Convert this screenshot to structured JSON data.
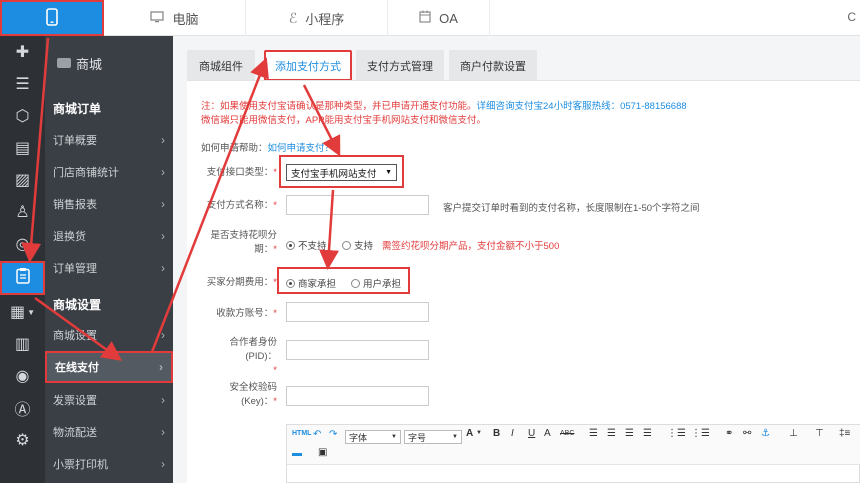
{
  "topbar": {
    "phone_icon": "phone-icon",
    "tabs": [
      {
        "label": "电脑",
        "icon": "monitor-icon"
      },
      {
        "label": "小程序",
        "icon": "miniprogram-icon"
      },
      {
        "label": "OA",
        "icon": "calendar-icon"
      }
    ],
    "right_label": "C"
  },
  "rail": {
    "items": [
      {
        "icon": "puzzle-icon",
        "glyph": "✚"
      },
      {
        "icon": "list-icon",
        "glyph": "☰"
      },
      {
        "icon": "cube-icon",
        "glyph": "⬡"
      },
      {
        "icon": "document-icon",
        "glyph": "▤"
      },
      {
        "icon": "image-icon",
        "glyph": "▨"
      },
      {
        "icon": "user-icon",
        "glyph": "♙"
      },
      {
        "icon": "game-icon",
        "glyph": "◎"
      },
      {
        "icon": "clipboard-icon",
        "glyph": "▣"
      },
      {
        "icon": "grid-icon",
        "glyph": "▦"
      },
      {
        "icon": "order-icon",
        "glyph": "▥"
      },
      {
        "icon": "chat-icon",
        "glyph": "◉"
      },
      {
        "icon": "appstore-icon",
        "glyph": "Ⓐ"
      },
      {
        "icon": "settings-icon",
        "glyph": "⚙"
      }
    ]
  },
  "sidenav": {
    "title": "商城",
    "group1": "商城订单",
    "group1_items": [
      "订单概要",
      "门店商铺统计",
      "销售报表",
      "退换货",
      "订单管理"
    ],
    "group2": "商城设置",
    "group2_items": [
      "商城设置",
      "在线支付",
      "发票设置",
      "物流配送",
      "小票打印机"
    ]
  },
  "tabs": [
    "商城组件",
    "添加支付方式",
    "支付方式管理",
    "商户付款设置"
  ],
  "notice": {
    "line1": "注：如果使用支付宝请确认是那种类型，并已申请开通支付功能。",
    "line1_link": "详细咨询支付宝24小时客服热线：0571-88156688",
    "line2": "微信端只能用微信支付，APP能用支付宝手机网站支付和微信支付。"
  },
  "help": {
    "label": "如何申请帮助：",
    "link": "如何申请支付？"
  },
  "form": {
    "type_label": "支付接口类型：",
    "type_value": "支付宝手机网站支付",
    "name_label": "支付方式名称：",
    "name_hint": "客户提交订单时看到的支付名称，长度限制在1-50个字符之间",
    "huabei_label_1": "是否支持花呗分",
    "huabei_label_2": "期：",
    "huabei_no": "不支持",
    "huabei_yes": "支持",
    "huabei_note": "需签约花呗分期产品，支付金额不小于500",
    "installment_label": "买家分期费用：",
    "installment_merchant": "商家承担",
    "installment_user": "用户承担",
    "account_label": "收款方账号：",
    "pid_label": "合作者身份(PID)：",
    "key_label_1": "安全校验码",
    "key_label_2": "(Key)：",
    "required_mark": "*"
  },
  "editor": {
    "html": "HTML",
    "font_family": "字体",
    "font_size": "字号",
    "bold": "B",
    "italic": "I",
    "underline": "U",
    "strike": "ABC",
    "font_color": "A"
  }
}
